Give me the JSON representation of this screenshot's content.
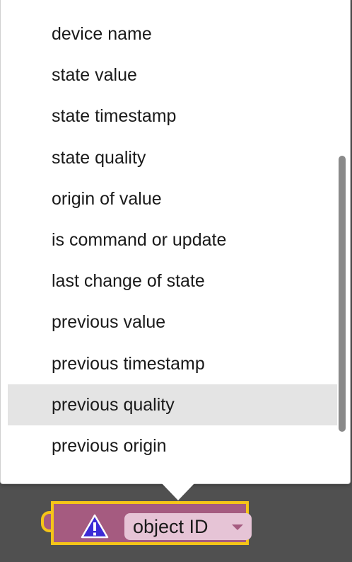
{
  "menu": {
    "items": [
      {
        "label": "device name"
      },
      {
        "label": "state value"
      },
      {
        "label": "state timestamp"
      },
      {
        "label": "state quality"
      },
      {
        "label": "origin of value"
      },
      {
        "label": "is command or update"
      },
      {
        "label": "last change of state"
      },
      {
        "label": "previous value"
      },
      {
        "label": "previous timestamp"
      },
      {
        "label": "previous quality"
      },
      {
        "label": "previous origin"
      }
    ],
    "highlighted_index": 9
  },
  "block": {
    "field_label": "object ID",
    "icon": "warning-icon",
    "colors": {
      "block_fill": "#a55b80",
      "block_border": "#f5c518",
      "field_fill": "#e6c4d6",
      "warning": "#3b2bd6"
    }
  }
}
